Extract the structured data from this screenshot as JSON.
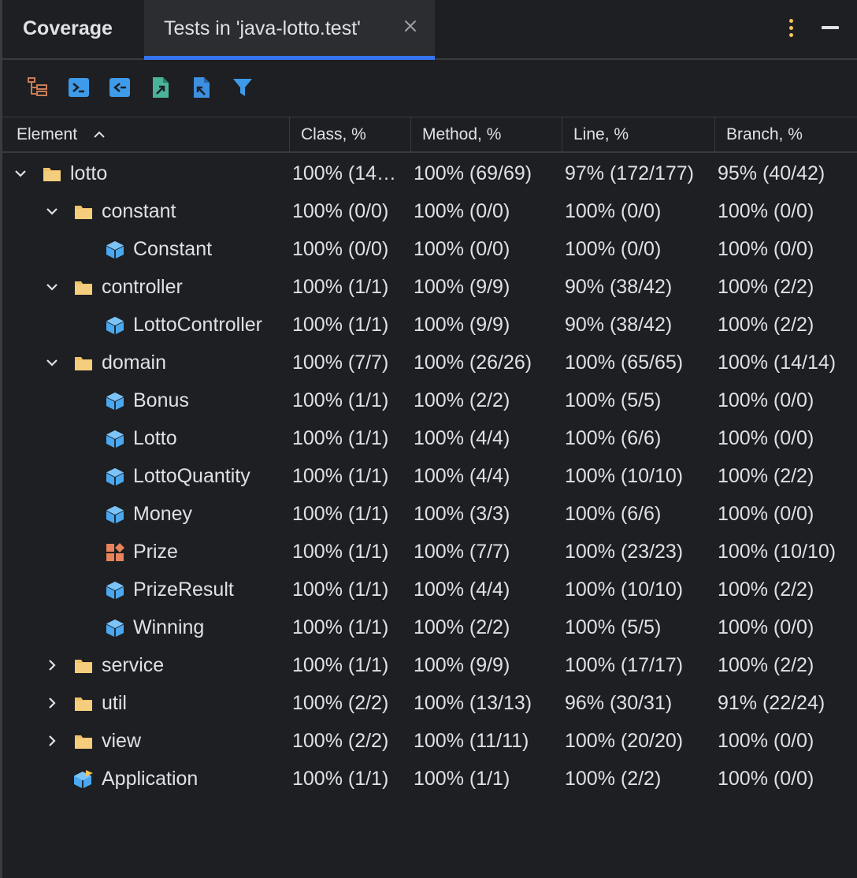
{
  "tabs": {
    "coverage_label": "Coverage",
    "active_label": "Tests in 'java-lotto.test'"
  },
  "toolbar": {
    "icons": [
      "flatten-packages-icon",
      "navigate-to-source-icon",
      "navigate-from-source-icon",
      "import-coverage-icon",
      "export-coverage-icon",
      "filter-icon"
    ]
  },
  "columns": {
    "element": "Element",
    "class": "Class, %",
    "method": "Method, %",
    "line": "Line, %",
    "branch": "Branch, %"
  },
  "rows": [
    {
      "name": "lotto",
      "kind": "folder",
      "expand": "open",
      "class": "100% (14…",
      "method": "100% (69/69)",
      "line": "97% (172/177)",
      "branch": "95% (40/42)"
    },
    {
      "name": "constant",
      "kind": "folder",
      "expand": "open",
      "class": "100% (0/0)",
      "method": "100% (0/0)",
      "line": "100% (0/0)",
      "branch": "100% (0/0)"
    },
    {
      "name": "Constant",
      "kind": "class",
      "expand": "none",
      "class": "100% (0/0)",
      "method": "100% (0/0)",
      "line": "100% (0/0)",
      "branch": "100% (0/0)"
    },
    {
      "name": "controller",
      "kind": "folder",
      "expand": "open",
      "class": "100% (1/1)",
      "method": "100% (9/9)",
      "line": "90% (38/42)",
      "branch": "100% (2/2)"
    },
    {
      "name": "LottoController",
      "kind": "class",
      "expand": "none",
      "class": "100% (1/1)",
      "method": "100% (9/9)",
      "line": "90% (38/42)",
      "branch": "100% (2/2)"
    },
    {
      "name": "domain",
      "kind": "folder",
      "expand": "open",
      "class": "100% (7/7)",
      "method": "100% (26/26)",
      "line": "100% (65/65)",
      "branch": "100% (14/14)"
    },
    {
      "name": "Bonus",
      "kind": "class",
      "expand": "none",
      "class": "100% (1/1)",
      "method": "100% (2/2)",
      "line": "100% (5/5)",
      "branch": "100% (0/0)"
    },
    {
      "name": "Lotto",
      "kind": "class",
      "expand": "none",
      "class": "100% (1/1)",
      "method": "100% (4/4)",
      "line": "100% (6/6)",
      "branch": "100% (0/0)"
    },
    {
      "name": "LottoQuantity",
      "kind": "class",
      "expand": "none",
      "class": "100% (1/1)",
      "method": "100% (4/4)",
      "line": "100% (10/10)",
      "branch": "100% (2/2)"
    },
    {
      "name": "Money",
      "kind": "class",
      "expand": "none",
      "class": "100% (1/1)",
      "method": "100% (3/3)",
      "line": "100% (6/6)",
      "branch": "100% (0/0)"
    },
    {
      "name": "Prize",
      "kind": "enum",
      "expand": "none",
      "class": "100% (1/1)",
      "method": "100% (7/7)",
      "line": "100% (23/23)",
      "branch": "100% (10/10)"
    },
    {
      "name": "PrizeResult",
      "kind": "class",
      "expand": "none",
      "class": "100% (1/1)",
      "method": "100% (4/4)",
      "line": "100% (10/10)",
      "branch": "100% (2/2)"
    },
    {
      "name": "Winning",
      "kind": "class",
      "expand": "none",
      "class": "100% (1/1)",
      "method": "100% (2/2)",
      "line": "100% (5/5)",
      "branch": "100% (0/0)"
    },
    {
      "name": "service",
      "kind": "folder",
      "expand": "closed",
      "class": "100% (1/1)",
      "method": "100% (9/9)",
      "line": "100% (17/17)",
      "branch": "100% (2/2)"
    },
    {
      "name": "util",
      "kind": "folder",
      "expand": "closed",
      "class": "100% (2/2)",
      "method": "100% (13/13)",
      "line": "96% (30/31)",
      "branch": "91% (22/24)"
    },
    {
      "name": "view",
      "kind": "folder",
      "expand": "closed",
      "class": "100% (2/2)",
      "method": "100% (11/11)",
      "line": "100% (20/20)",
      "branch": "100% (0/0)"
    },
    {
      "name": "Application",
      "kind": "app",
      "expand": "none",
      "class": "100% (1/1)",
      "method": "100% (1/1)",
      "line": "100% (2/2)",
      "branch": "100% (0/0)"
    }
  ]
}
